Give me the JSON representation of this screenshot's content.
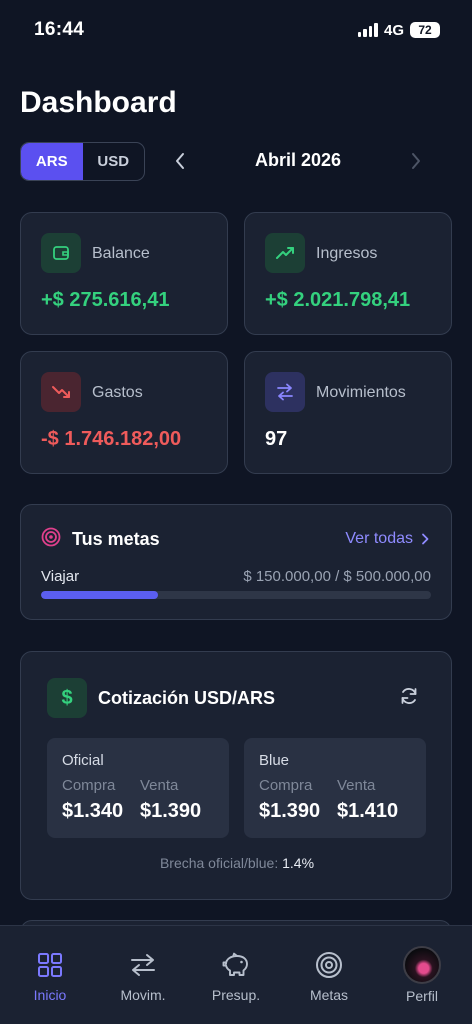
{
  "status_bar": {
    "time": "16:44",
    "network": "4G",
    "battery": "72"
  },
  "header": {
    "title": "Dashboard"
  },
  "currency_toggle": {
    "options": [
      "ARS",
      "USD"
    ],
    "selected": "ARS"
  },
  "period": {
    "label": "Abril 2026",
    "prev_icon": "chevron-left-icon",
    "next_icon": "chevron-right-icon"
  },
  "stats": [
    {
      "label": "Balance",
      "value": "+$ 275.616,41",
      "icon": "wallet-icon",
      "color": "#34d17e"
    },
    {
      "label": "Ingresos",
      "value": "+$ 2.021.798,41",
      "icon": "trending-up-icon",
      "color": "#34d17e"
    },
    {
      "label": "Gastos",
      "value": "-$ 1.746.182,00",
      "icon": "trending-down-icon",
      "color": "#ef5b5b"
    },
    {
      "label": "Movimientos",
      "value": "97",
      "icon": "arrows-exchange-icon",
      "color": "#ffffff"
    }
  ],
  "goals": {
    "title": "Tus metas",
    "see_all": "Ver todas",
    "items": [
      {
        "name": "Viajar",
        "amount": "$ 150.000,00 / $ 500.000,00",
        "progress": 0.3
      }
    ]
  },
  "exchange": {
    "title": "Cotización USD/ARS",
    "boxes": [
      {
        "name": "Oficial",
        "buy_label": "Compra",
        "sell_label": "Venta",
        "buy": "$1.340",
        "sell": "$1.390"
      },
      {
        "name": "Blue",
        "buy_label": "Compra",
        "sell_label": "Venta",
        "buy": "$1.390",
        "sell": "$1.410"
      }
    ],
    "gap_label": "Brecha oficial/blue:",
    "gap_value": "1.4%"
  },
  "nav": {
    "items": [
      {
        "label": "Inicio",
        "icon": "grid-icon",
        "active": true
      },
      {
        "label": "Movim.",
        "icon": "arrows-exchange-icon",
        "active": false
      },
      {
        "label": "Presup.",
        "icon": "piggy-bank-icon",
        "active": false
      },
      {
        "label": "Metas",
        "icon": "target-icon",
        "active": false
      },
      {
        "label": "Perfil",
        "icon": "avatar",
        "active": false
      }
    ]
  },
  "colors": {
    "accent": "#5b50f0",
    "positive": "#34d17e",
    "negative": "#ef5b5b",
    "background": "#0f1524",
    "card": "#1b2232"
  }
}
